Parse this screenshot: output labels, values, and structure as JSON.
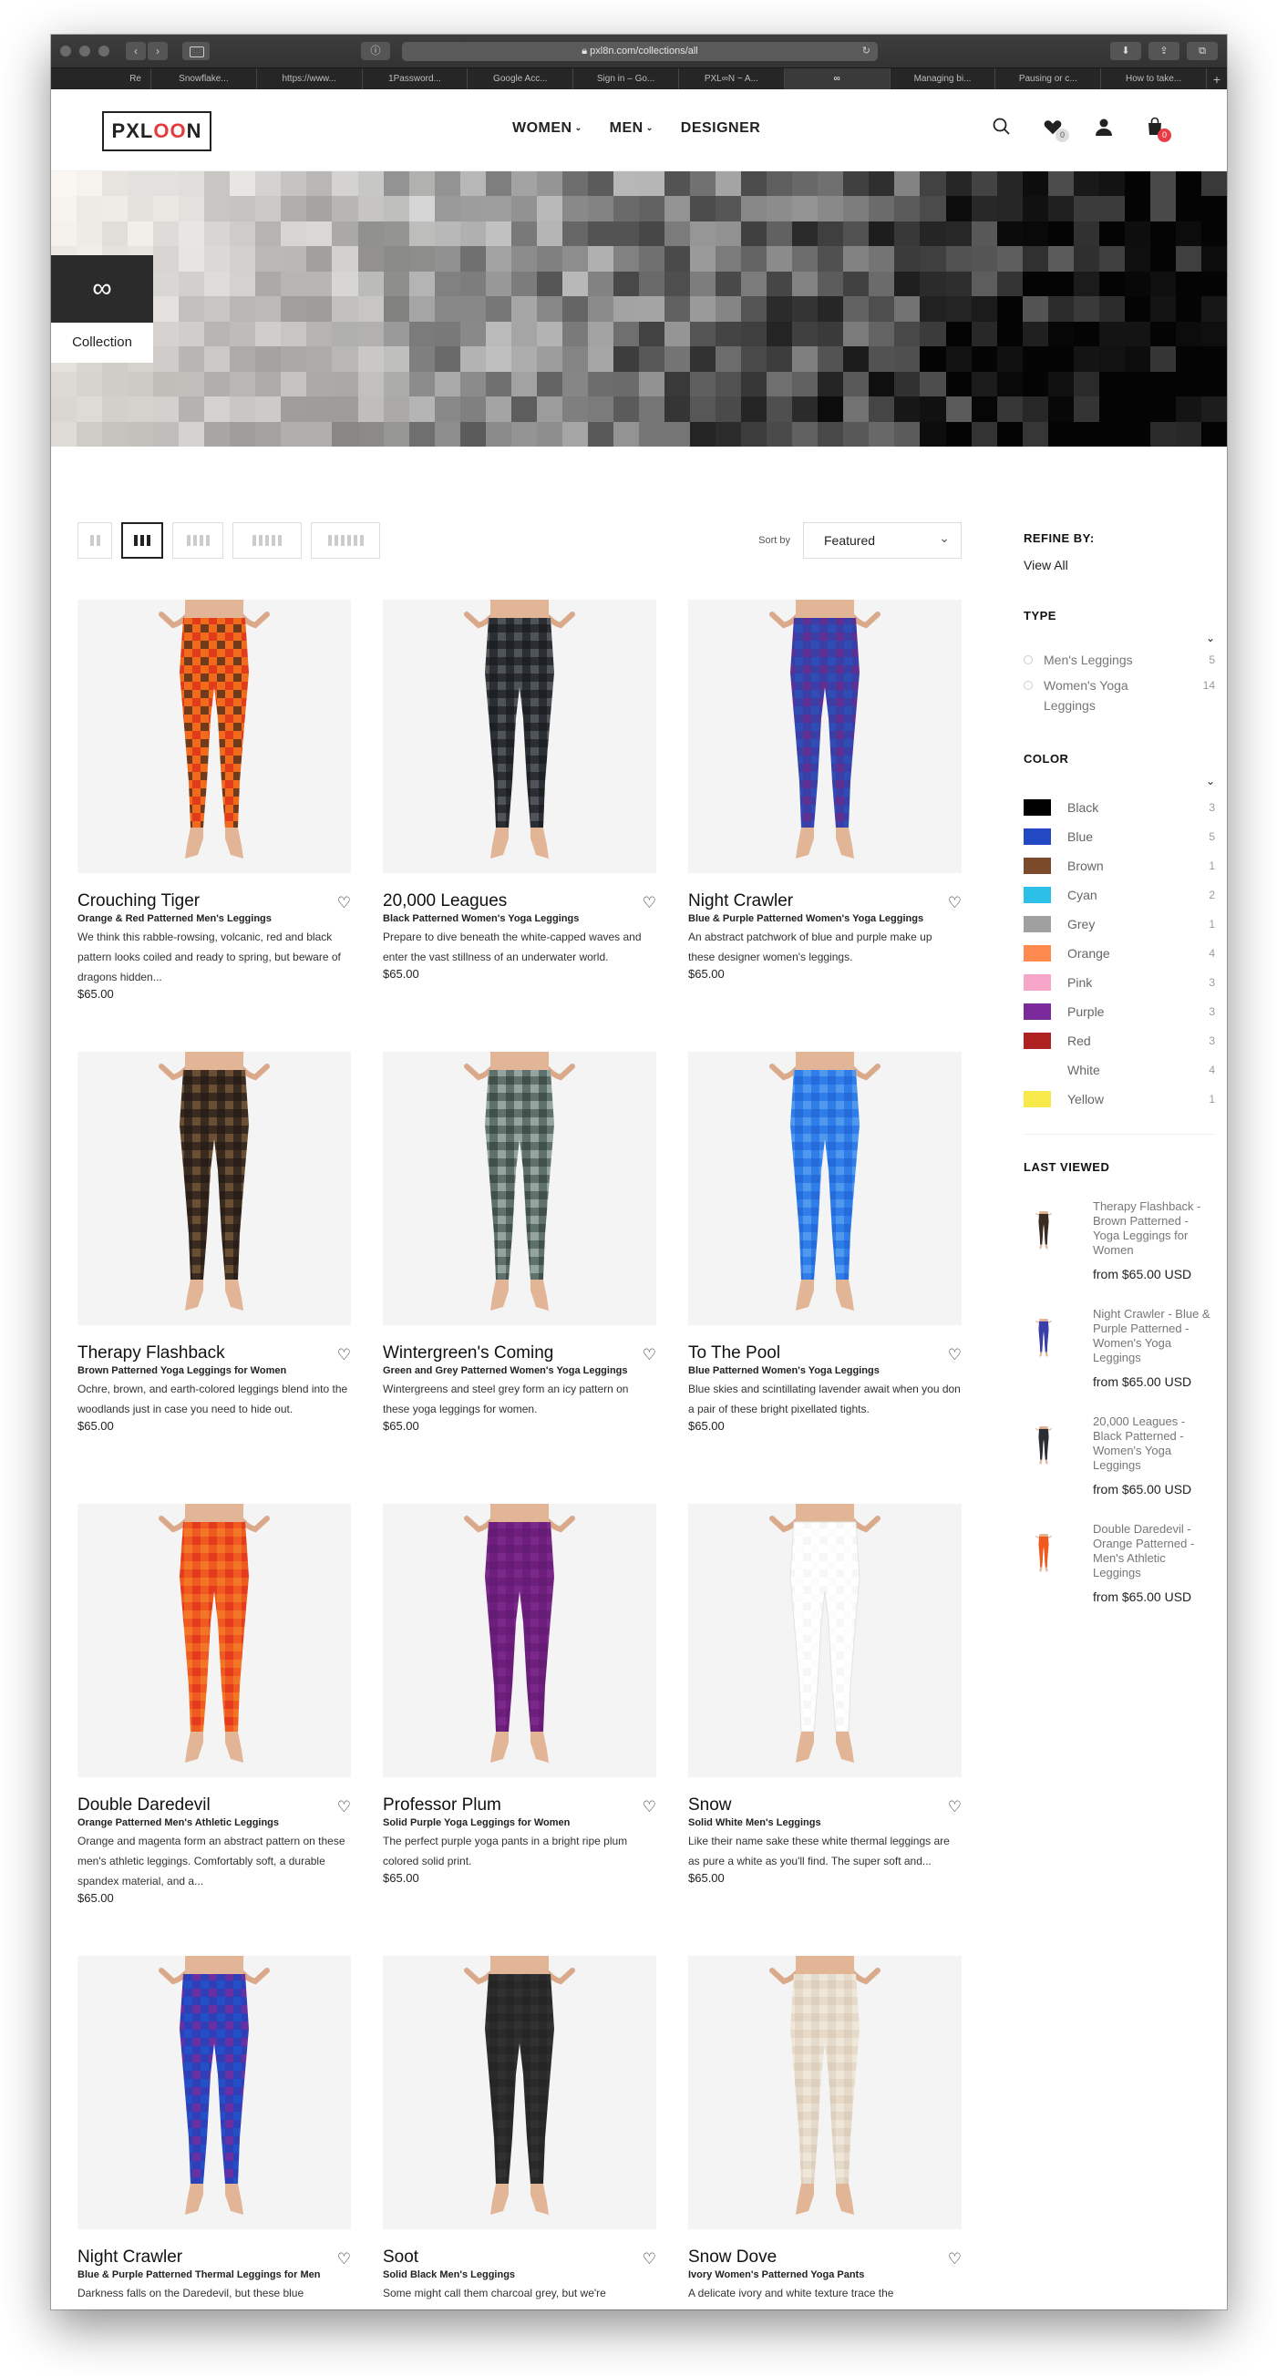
{
  "browser": {
    "url": "pxl8n.com/collections/all",
    "tabs": [
      "Re",
      "Snowflake...",
      "https://www...",
      "1Password...",
      "Google Acc...",
      "Sign in – Go...",
      "PXL∞N ~ A...",
      "∞",
      "Managing bi...",
      "Pausing or c...",
      "How to take..."
    ],
    "active_tab_index": 7
  },
  "header": {
    "logo": {
      "prefix": "PXL",
      "oo": "OO",
      "suffix": "N"
    },
    "nav": [
      {
        "label": "WOMEN",
        "caret": true
      },
      {
        "label": "MEN",
        "caret": true
      },
      {
        "label": "DESIGNER",
        "caret": false
      }
    ],
    "wishlist_count": "0",
    "cart_count": "0"
  },
  "hero": {
    "symbol": "∞",
    "subtitle": "Collection"
  },
  "toolbar": {
    "sort_label": "Sort by",
    "sort_value": "Featured",
    "view_columns": [
      2,
      3,
      4,
      5,
      6
    ],
    "active_view": 3
  },
  "products": [
    {
      "title": "Crouching Tiger",
      "subtitle": "Orange & Red Patterned Men's Leggings",
      "desc": "We think this rabble-rowsing, volcanic, red and black pattern looks coiled and ready to spring, but beware of dragons hidden...",
      "price": "$65.00",
      "colors": [
        "#f26a1b",
        "#d92b1a",
        "#1a1a1a"
      ]
    },
    {
      "title": "20,000 Leagues",
      "subtitle": "Black Patterned Women's Yoga Leggings",
      "desc": "Prepare to dive beneath the white-capped waves and enter the vast stillness of an underwater world.",
      "price": "$65.00",
      "colors": [
        "#2b2f33",
        "#5a6066",
        "#15181b"
      ]
    },
    {
      "title": "Night Crawler",
      "subtitle": "Blue & Purple Patterned Women's Yoga Leggings",
      "desc": "An abstract patchwork of blue and purple make up these designer women's leggings.",
      "price": "$65.00",
      "colors": [
        "#3a3fa8",
        "#6a2a8a",
        "#2a56c0"
      ]
    },
    {
      "title": "Therapy Flashback",
      "subtitle": "Brown Patterned Yoga Leggings for Women",
      "desc": "Ochre, brown, and earth-colored leggings blend into the woodlands just in case you need to hide out.",
      "price": "$65.00",
      "colors": [
        "#3a2b20",
        "#7a5a3a",
        "#1e1712"
      ]
    },
    {
      "title": "Wintergreen's Coming",
      "subtitle": "Green and Grey Patterned Women's Yoga Leggings",
      "desc": "Wintergreens and steel grey form an icy pattern on these yoga leggings for women.",
      "price": "$65.00",
      "colors": [
        "#5e716c",
        "#a8b5b0",
        "#2e3a37"
      ]
    },
    {
      "title": "To The Pool",
      "subtitle": "Blue Patterned Women's Yoga Leggings",
      "desc": "Blue skies and scintillating lavender await when you don a pair of these bright pixellated tights.",
      "price": "$65.00",
      "colors": [
        "#2f7de8",
        "#5aa0f0",
        "#1f5fd0"
      ]
    },
    {
      "title": "Double Daredevil",
      "subtitle": "Orange Patterned Men's Athletic Leggings",
      "desc": "Orange and magenta form an abstract pattern on these men's athletic leggings. Comfortably soft, a durable spandex material, and a...",
      "price": "$65.00",
      "colors": [
        "#f05a20",
        "#e0301e",
        "#f28a2a"
      ]
    },
    {
      "title": "Professor Plum",
      "subtitle": "Solid Purple Yoga Leggings for Women",
      "desc": "The perfect purple yoga pants in a bright ripe plum colored solid print.",
      "price": "$65.00",
      "colors": [
        "#6e1f7e",
        "#7e2a8e",
        "#5e1a6e"
      ]
    },
    {
      "title": "Snow",
      "subtitle": "Solid White Men's Leggings",
      "desc": "Like their name sake these white thermal leggings are as pure a white as you'll find. The super soft and...",
      "price": "$65.00",
      "colors": [
        "#ffffff",
        "#f4f4f4",
        "#fafafa"
      ]
    },
    {
      "title": "Night Crawler",
      "subtitle": "Blue & Purple Patterned Thermal Leggings for Men",
      "desc": "Darkness falls on the Daredevil, but these blue",
      "price": "",
      "colors": [
        "#2e3fb8",
        "#7a2a9a",
        "#1e5ad0"
      ]
    },
    {
      "title": "Soot",
      "subtitle": "Solid Black Men's Leggings",
      "desc": "Some might call them charcoal grey, but we're",
      "price": "",
      "colors": [
        "#2a2a2a",
        "#333333",
        "#222222"
      ]
    },
    {
      "title": "Snow Dove",
      "subtitle": "Ivory Women's Patterned Yoga Pants",
      "desc": "A delicate ivory and white texture trace the",
      "price": "",
      "colors": [
        "#e6dacb",
        "#f2eae0",
        "#d8c8b4"
      ]
    }
  ],
  "sidebar": {
    "refine_title": "REFINE BY:",
    "view_all": "View All",
    "type_title": "TYPE",
    "types": [
      {
        "label": "Men's Leggings",
        "count": "5"
      },
      {
        "label": "Women's Yoga Leggings",
        "count": "14"
      }
    ],
    "color_title": "COLOR",
    "colors": [
      {
        "label": "Black",
        "count": "3",
        "hex": "#000000"
      },
      {
        "label": "Blue",
        "count": "5",
        "hex": "#2348c4"
      },
      {
        "label": "Brown",
        "count": "1",
        "hex": "#7a4a2a"
      },
      {
        "label": "Cyan",
        "count": "2",
        "hex": "#2cc0e8"
      },
      {
        "label": "Grey",
        "count": "1",
        "hex": "#a0a0a0"
      },
      {
        "label": "Orange",
        "count": "4",
        "hex": "#ff8a50"
      },
      {
        "label": "Pink",
        "count": "3",
        "hex": "#f6a6c8"
      },
      {
        "label": "Purple",
        "count": "3",
        "hex": "#7a2a9a"
      },
      {
        "label": "Red",
        "count": "3",
        "hex": "#b02222"
      },
      {
        "label": "White",
        "count": "4",
        "hex": "#ffffff"
      },
      {
        "label": "Yellow",
        "count": "1",
        "hex": "#f8e94a"
      }
    ],
    "last_viewed_title": "LAST VIEWED",
    "last_viewed": [
      {
        "title": "Therapy Flashback - Brown Patterned - Yoga Leggings for Women",
        "price": "from $65.00 USD",
        "color": "#3a2b20"
      },
      {
        "title": "Night Crawler - Blue & Purple Patterned - Women's Yoga Leggings",
        "price": "from $65.00 USD",
        "color": "#3a3fa8"
      },
      {
        "title": "20,000 Leagues - Black Patterned - Women's Yoga Leggings",
        "price": "from $65.00 USD",
        "color": "#2b2f33"
      },
      {
        "title": "Double Daredevil - Orange Patterned - Men's Athletic Leggings",
        "price": "from $65.00 USD",
        "color": "#f05a20"
      }
    ]
  }
}
